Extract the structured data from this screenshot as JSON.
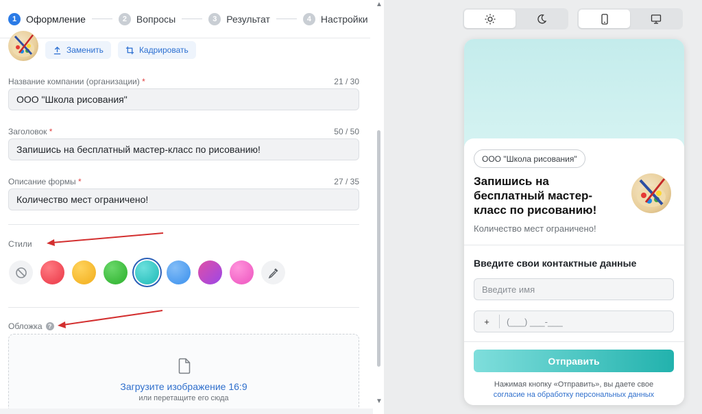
{
  "steps": [
    {
      "num": "1",
      "label": "Оформление"
    },
    {
      "num": "2",
      "label": "Вопросы"
    },
    {
      "num": "3",
      "label": "Результат"
    },
    {
      "num": "4",
      "label": "Настройки"
    }
  ],
  "logo_actions": {
    "replace": "Заменить",
    "crop": "Кадрировать"
  },
  "fields": {
    "company": {
      "label": "Название компании (организации)",
      "required": "*",
      "count": "21 / 30",
      "value": "ООО \"Школа рисования\""
    },
    "title": {
      "label": "Заголовок",
      "required": "*",
      "count": "50 / 50",
      "value": "Запишись на бесплатный мастер-класс по рисованию!"
    },
    "description": {
      "label": "Описание формы",
      "required": "*",
      "count": "27 / 35",
      "value": "Количество мест ограничено!"
    }
  },
  "styles": {
    "title": "Стили",
    "colors": [
      "#f04a57",
      "#f5b82e",
      "#3dbb3d",
      "#35c5c2",
      "#4f9df0",
      "#c44ce6",
      "#f266c7"
    ],
    "selected_index": 3
  },
  "cover": {
    "title": "Обложка",
    "help": "?",
    "upload_title": "Загрузите изображение 16:9",
    "upload_sub": "или перетащите его сюда"
  },
  "preview": {
    "company_pill": "ООО \"Школа рисования\"",
    "title": "Запишись на бесплатный мастер-класс по рисованию!",
    "description": "Количество мест ограничено!",
    "contact_title": "Введите свои контактные данные",
    "name_placeholder": "Введите имя",
    "phone_plus": "+",
    "phone_mask": "(___) ___-___",
    "submit": "Отправить",
    "consent_text": "Нажимая кнопку «Отправить», вы даете свое",
    "consent_link": "согласие на обработку персональных данных"
  },
  "accent": "#2b7be6"
}
